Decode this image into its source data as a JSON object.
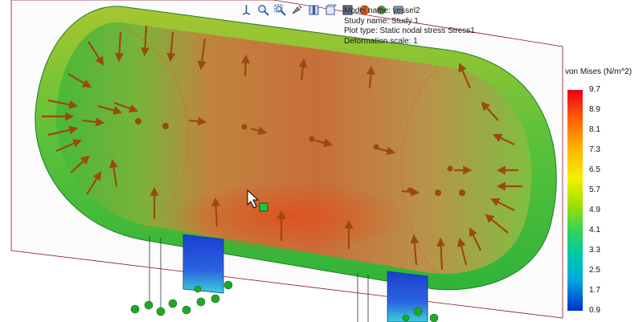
{
  "toolbar": {
    "buttons": [
      {
        "name": "orient-icon"
      },
      {
        "name": "zoom-to-fit-icon"
      },
      {
        "name": "zoom-area-icon"
      },
      {
        "name": "rotate-view-icon"
      },
      {
        "name": "section-view-icon"
      },
      {
        "name": "view-orientation-icon"
      },
      {
        "name": "display-style-icon"
      },
      {
        "name": "hide-show-icon"
      },
      {
        "name": "appearance-icon"
      },
      {
        "name": "scene-icon"
      }
    ]
  },
  "info": {
    "model_name": "Model name: vessel2",
    "study_name": "Study name: Study 1",
    "plot_type": "Plot type: Static nodal stress Stress1",
    "deformation_scale": "Deformation scale: 1"
  },
  "legend": {
    "title": "von Mises (N/m^2)",
    "labels": [
      "9.7",
      "8.9",
      "8.1",
      "7.3",
      "6.5",
      "5.7",
      "4.9",
      "4.1",
      "3.3",
      "2.5",
      "1.7",
      "0.9"
    ],
    "colors": {
      "max": "#e8001a",
      "mid": "#9fe000",
      "min": "#0030d0"
    }
  },
  "colors": {
    "shell": "#2ec23c",
    "load_arrow": "#9a4a10",
    "fixture": "#1fa82a",
    "probe": "#22c24a"
  }
}
